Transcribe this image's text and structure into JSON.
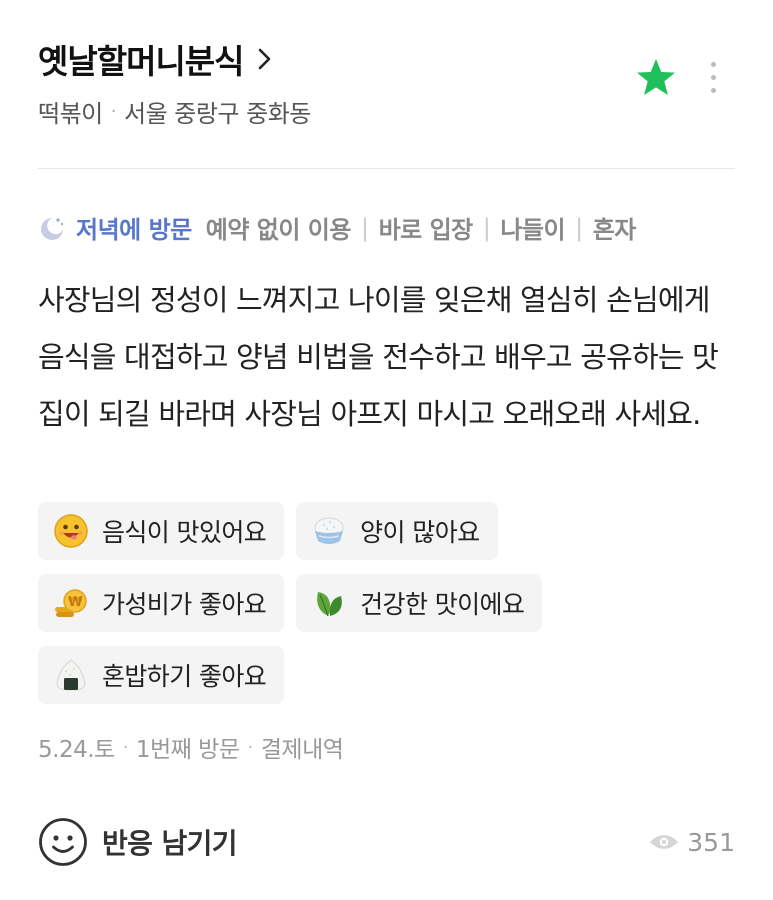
{
  "place": {
    "name": "옛날할머니분식",
    "category": "떡볶이",
    "location": "서울 중랑구 중화동"
  },
  "colors": {
    "star": "#1fbf5a",
    "visit_label": "#5a76c8"
  },
  "visit": {
    "label": "저녁에 방문",
    "tags": [
      "예약 없이 이용",
      "바로 입장",
      "나들이",
      "혼자"
    ]
  },
  "review": {
    "text": "사장님의 정성이 느껴지고 나이를 잊은채 열심히 손님에게 음식을 대접하고 양념 비법을 전수하고 배우고 공유하는 맛집이 되길 바라며 사장님 아프지 마시고 오래오래 사세요."
  },
  "keywords": [
    {
      "label": "음식이 맛있어요",
      "icon": "smiley-face-icon"
    },
    {
      "label": "양이 많아요",
      "icon": "rice-bowl-icon"
    },
    {
      "label": "가성비가 좋아요",
      "icon": "coins-icon"
    },
    {
      "label": "건강한 맛이에요",
      "icon": "leaf-icon"
    },
    {
      "label": "혼밥하기 좋아요",
      "icon": "rice-ball-icon"
    }
  ],
  "meta": {
    "date": "5.24.토",
    "visit_count": "1번째 방문",
    "payment": "결제내역"
  },
  "footer": {
    "react_label": "반응 남기기",
    "views": "351"
  }
}
